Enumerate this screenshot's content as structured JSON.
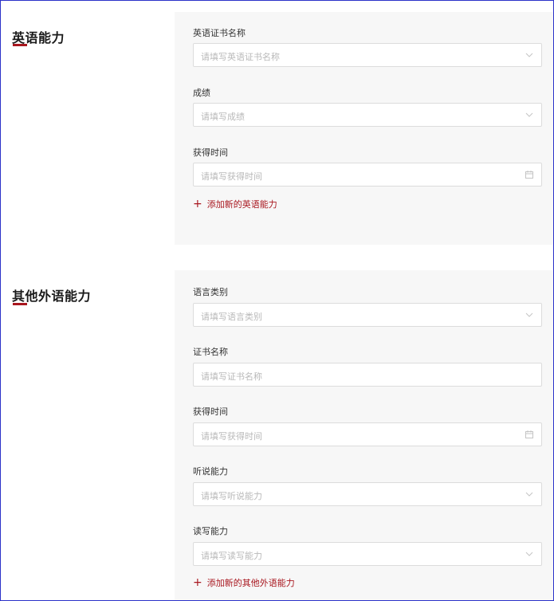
{
  "english": {
    "title": "英语能力",
    "fields": [
      {
        "label": "英语证书名称",
        "placeholder": "请填写英语证书名称",
        "icon": "chevron-down-icon"
      },
      {
        "label": "成绩",
        "placeholder": "请填写成绩",
        "icon": "chevron-down-icon"
      },
      {
        "label": "获得时间",
        "placeholder": "请填写获得时间",
        "icon": "calendar-icon"
      }
    ],
    "add_label": "添加新的英语能力"
  },
  "other": {
    "title": "其他外语能力",
    "fields": [
      {
        "label": "语言类别",
        "placeholder": "请填写语言类别",
        "icon": "chevron-down-icon"
      },
      {
        "label": "证书名称",
        "placeholder": "请填写证书名称",
        "icon": ""
      },
      {
        "label": "获得时间",
        "placeholder": "请填写获得时间",
        "icon": "calendar-icon"
      },
      {
        "label": "听说能力",
        "placeholder": "请填写听说能力",
        "icon": "chevron-down-icon"
      },
      {
        "label": "读写能力",
        "placeholder": "请填写读写能力",
        "icon": "chevron-down-icon"
      }
    ],
    "add_label": "添加新的其他外语能力"
  },
  "colors": {
    "accent": "#a8161e",
    "panel_bg": "#f7f7f7",
    "border": "#dcdcdc",
    "placeholder": "#b9b9b9"
  }
}
